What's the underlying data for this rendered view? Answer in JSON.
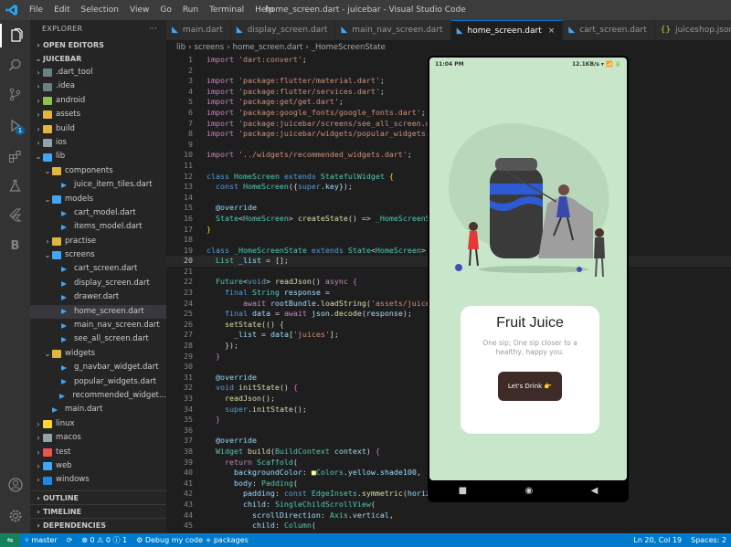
{
  "titlebar": {
    "menu": [
      "File",
      "Edit",
      "Selection",
      "View",
      "Go",
      "Run",
      "Terminal",
      "Help"
    ],
    "title": "home_screen.dart - juicebar - Visual Studio Code"
  },
  "activity_bar": {
    "icons": [
      "files-icon",
      "search-icon",
      "source-control-icon",
      "run-debug-icon",
      "extensions-icon",
      "testing-icon",
      "flutter-icon",
      "bloc-icon"
    ],
    "debug_badge": "1",
    "bottom_icons": [
      "account-icon",
      "settings-gear-icon"
    ]
  },
  "sidebar": {
    "title": "EXPLORER",
    "open_editors": "OPEN EDITORS",
    "project": "JUICEBAR",
    "tree": [
      {
        "label": ".dart_tool",
        "depth": 1,
        "type": "folder",
        "open": false
      },
      {
        "label": ".idea",
        "depth": 1,
        "type": "folder",
        "open": false
      },
      {
        "label": "android",
        "depth": 1,
        "type": "folder",
        "open": false
      },
      {
        "label": "assets",
        "depth": 1,
        "type": "folder",
        "open": false
      },
      {
        "label": "build",
        "depth": 1,
        "type": "folder",
        "open": false
      },
      {
        "label": "ios",
        "depth": 1,
        "type": "folder",
        "open": false
      },
      {
        "label": "lib",
        "depth": 1,
        "type": "folder",
        "open": true
      },
      {
        "label": "components",
        "depth": 2,
        "type": "folder",
        "open": true
      },
      {
        "label": "juice_item_tiles.dart",
        "depth": 3,
        "type": "dart"
      },
      {
        "label": "models",
        "depth": 2,
        "type": "folder",
        "open": true
      },
      {
        "label": "cart_model.dart",
        "depth": 3,
        "type": "dart"
      },
      {
        "label": "items_model.dart",
        "depth": 3,
        "type": "dart"
      },
      {
        "label": "practise",
        "depth": 2,
        "type": "folder",
        "open": false
      },
      {
        "label": "screens",
        "depth": 2,
        "type": "folder",
        "open": true
      },
      {
        "label": "cart_screen.dart",
        "depth": 3,
        "type": "dart"
      },
      {
        "label": "display_screen.dart",
        "depth": 3,
        "type": "dart"
      },
      {
        "label": "drawer.dart",
        "depth": 3,
        "type": "dart"
      },
      {
        "label": "home_screen.dart",
        "depth": 3,
        "type": "dart",
        "selected": true
      },
      {
        "label": "main_nav_screen.dart",
        "depth": 3,
        "type": "dart"
      },
      {
        "label": "see_all_screen.dart",
        "depth": 3,
        "type": "dart"
      },
      {
        "label": "widgets",
        "depth": 2,
        "type": "folder",
        "open": true
      },
      {
        "label": "g_navbar_widget.dart",
        "depth": 3,
        "type": "dart"
      },
      {
        "label": "popular_widgets.dart",
        "depth": 3,
        "type": "dart"
      },
      {
        "label": "recommended_widget...",
        "depth": 3,
        "type": "dart"
      },
      {
        "label": "main.dart",
        "depth": 2,
        "type": "dart"
      },
      {
        "label": "linux",
        "depth": 1,
        "type": "folder",
        "open": false
      },
      {
        "label": "macos",
        "depth": 1,
        "type": "folder",
        "open": false
      },
      {
        "label": "test",
        "depth": 1,
        "type": "folder",
        "open": false
      },
      {
        "label": "web",
        "depth": 1,
        "type": "folder",
        "open": false
      },
      {
        "label": "windows",
        "depth": 1,
        "type": "folder",
        "open": false
      }
    ],
    "outline": "OUTLINE",
    "timeline": "TIMELINE",
    "dependencies": "DEPENDENCIES"
  },
  "tabs": [
    {
      "label": "main.dart",
      "icon": "dart",
      "active": false
    },
    {
      "label": "display_screen.dart",
      "icon": "dart",
      "active": false
    },
    {
      "label": "main_nav_screen.dart",
      "icon": "dart",
      "active": false
    },
    {
      "label": "home_screen.dart",
      "icon": "dart",
      "active": true,
      "close": "×"
    },
    {
      "label": "cart_screen.dart",
      "icon": "dart",
      "active": false
    },
    {
      "label": "juiceshop.json",
      "icon": "json",
      "active": false
    }
  ],
  "breadcrumb": [
    "lib",
    "screens",
    "home_screen.dart",
    "_HomeScreenState"
  ],
  "editor": {
    "current_line": 20,
    "lines": [
      [
        [
          "import ",
          "#c586c0"
        ],
        [
          "'dart:convert'",
          "#ce9178"
        ],
        [
          ";",
          "#d4d4d4"
        ]
      ],
      [],
      [
        [
          "import ",
          "#c586c0"
        ],
        [
          "'package:flutter/material.dart'",
          "#ce9178"
        ],
        [
          ";",
          "#d4d4d4"
        ]
      ],
      [
        [
          "import ",
          "#c586c0"
        ],
        [
          "'package:flutter/services.dart'",
          "#ce9178"
        ],
        [
          ";",
          "#d4d4d4"
        ]
      ],
      [
        [
          "import ",
          "#c586c0"
        ],
        [
          "'package:get/get.dart'",
          "#ce9178"
        ],
        [
          ";",
          "#d4d4d4"
        ]
      ],
      [
        [
          "import ",
          "#c586c0"
        ],
        [
          "'package:google_fonts/google_fonts.dart'",
          "#ce9178"
        ],
        [
          ";",
          "#d4d4d4"
        ]
      ],
      [
        [
          "import ",
          "#c586c0"
        ],
        [
          "'package:juicebar/screens/see_all_screen.dart'",
          "#ce9178"
        ],
        [
          ";",
          "#d4d4d4"
        ]
      ],
      [
        [
          "import ",
          "#c586c0"
        ],
        [
          "'package:juicebar/widgets/popular_widgets.dart'",
          "#ce9178"
        ],
        [
          ";",
          "#d4d4d4"
        ]
      ],
      [],
      [
        [
          "import ",
          "#c586c0"
        ],
        [
          "'../widgets/recommended_widgets.dart'",
          "#ce9178"
        ],
        [
          ";",
          "#d4d4d4"
        ]
      ],
      [],
      [
        [
          "class ",
          "#569cd6"
        ],
        [
          "HomeScreen ",
          "#4ec9b0"
        ],
        [
          "extends ",
          "#569cd6"
        ],
        [
          "StatefulWidget ",
          "#4ec9b0"
        ],
        [
          "{",
          "#ffd700"
        ]
      ],
      [
        [
          "  const ",
          "#569cd6"
        ],
        [
          "HomeScreen",
          "#4ec9b0"
        ],
        [
          "({",
          "#d4d4d4"
        ],
        [
          "super",
          "#569cd6"
        ],
        [
          ".",
          "#d4d4d4"
        ],
        [
          "key",
          "#9cdcfe"
        ],
        [
          "});",
          "#d4d4d4"
        ]
      ],
      [],
      [
        [
          "  @override",
          "#9cdcfe"
        ]
      ],
      [
        [
          "  State",
          "#4ec9b0"
        ],
        [
          "<",
          "#d4d4d4"
        ],
        [
          "HomeScreen",
          "#4ec9b0"
        ],
        [
          "> ",
          "#d4d4d4"
        ],
        [
          "createState",
          "#dcdcaa"
        ],
        [
          "() => ",
          "#d4d4d4"
        ],
        [
          "_HomeScreenState",
          "#4ec9b0"
        ],
        [
          "();",
          "#d4d4d4"
        ]
      ],
      [
        [
          "}",
          "#ffd700"
        ]
      ],
      [],
      [
        [
          "class ",
          "#569cd6"
        ],
        [
          "_HomeScreenState ",
          "#4ec9b0"
        ],
        [
          "extends ",
          "#569cd6"
        ],
        [
          "State",
          "#4ec9b0"
        ],
        [
          "<",
          "#d4d4d4"
        ],
        [
          "HomeScreen",
          "#4ec9b0"
        ],
        [
          "> ",
          "#d4d4d4"
        ],
        [
          "{",
          "#ffd700"
        ]
      ],
      [
        [
          "  List ",
          "#4ec9b0"
        ],
        [
          "_list ",
          "#9cdcfe"
        ],
        [
          "= [];",
          "#d4d4d4"
        ]
      ],
      [],
      [
        [
          "  Future",
          "#4ec9b0"
        ],
        [
          "<",
          "#d4d4d4"
        ],
        [
          "void",
          "#569cd6"
        ],
        [
          "> ",
          "#d4d4d4"
        ],
        [
          "readJson",
          "#dcdcaa"
        ],
        [
          "() ",
          "#d4d4d4"
        ],
        [
          "async ",
          "#c586c0"
        ],
        [
          "{",
          "#da70d6"
        ]
      ],
      [
        [
          "    final ",
          "#569cd6"
        ],
        [
          "String ",
          "#4ec9b0"
        ],
        [
          "response ",
          "#9cdcfe"
        ],
        [
          "=",
          "#d4d4d4"
        ]
      ],
      [
        [
          "        await ",
          "#c586c0"
        ],
        [
          "rootBundle",
          "#9cdcfe"
        ],
        [
          ".",
          "#d4d4d4"
        ],
        [
          "loadString",
          "#dcdcaa"
        ],
        [
          "(",
          "#d4d4d4"
        ],
        [
          "'assets/juiceshop.json'",
          "#ce9178"
        ],
        [
          ");",
          "#d4d4d4"
        ]
      ],
      [
        [
          "    final ",
          "#569cd6"
        ],
        [
          "data ",
          "#9cdcfe"
        ],
        [
          "= ",
          "#d4d4d4"
        ],
        [
          "await ",
          "#c586c0"
        ],
        [
          "json",
          "#9cdcfe"
        ],
        [
          ".",
          "#d4d4d4"
        ],
        [
          "decode",
          "#dcdcaa"
        ],
        [
          "(",
          "#d4d4d4"
        ],
        [
          "response",
          "#9cdcfe"
        ],
        [
          ");",
          "#d4d4d4"
        ]
      ],
      [
        [
          "    setState",
          "#dcdcaa"
        ],
        [
          "(() {",
          "#d4d4d4"
        ]
      ],
      [
        [
          "      _list ",
          "#9cdcfe"
        ],
        [
          "= ",
          "#d4d4d4"
        ],
        [
          "data",
          "#9cdcfe"
        ],
        [
          "[",
          "#d4d4d4"
        ],
        [
          "'juices'",
          "#ce9178"
        ],
        [
          "];",
          "#d4d4d4"
        ]
      ],
      [
        [
          "    });",
          "#d4d4d4"
        ]
      ],
      [
        [
          "  }",
          "#da70d6"
        ]
      ],
      [],
      [
        [
          "  @override",
          "#9cdcfe"
        ]
      ],
      [
        [
          "  void ",
          "#569cd6"
        ],
        [
          "initState",
          "#dcdcaa"
        ],
        [
          "() ",
          "#d4d4d4"
        ],
        [
          "{",
          "#da70d6"
        ]
      ],
      [
        [
          "    readJson",
          "#dcdcaa"
        ],
        [
          "();",
          "#d4d4d4"
        ]
      ],
      [
        [
          "    super",
          "#569cd6"
        ],
        [
          ".",
          "#d4d4d4"
        ],
        [
          "initState",
          "#dcdcaa"
        ],
        [
          "();",
          "#d4d4d4"
        ]
      ],
      [
        [
          "  }",
          "#da70d6"
        ]
      ],
      [],
      [
        [
          "  @override",
          "#9cdcfe"
        ]
      ],
      [
        [
          "  Widget ",
          "#4ec9b0"
        ],
        [
          "build",
          "#dcdcaa"
        ],
        [
          "(",
          "#d4d4d4"
        ],
        [
          "BuildContext ",
          "#4ec9b0"
        ],
        [
          "context",
          "#9cdcfe"
        ],
        [
          ") ",
          "#d4d4d4"
        ],
        [
          "{",
          "#da70d6"
        ]
      ],
      [
        [
          "    return ",
          "#c586c0"
        ],
        [
          "Scaffold",
          "#4ec9b0"
        ],
        [
          "(",
          "#d4d4d4"
        ]
      ],
      [
        [
          "      backgroundColor",
          "#9cdcfe"
        ],
        [
          ": ",
          "#d4d4d4"
        ],
        [
          "■",
          "#fff59d"
        ],
        [
          "Colors",
          "#4ec9b0"
        ],
        [
          ".",
          "#d4d4d4"
        ],
        [
          "yellow",
          "#9cdcfe"
        ],
        [
          ".",
          "#d4d4d4"
        ],
        [
          "shade100",
          "#9cdcfe"
        ],
        [
          ",",
          "#d4d4d4"
        ]
      ],
      [
        [
          "      body",
          "#9cdcfe"
        ],
        [
          ": ",
          "#d4d4d4"
        ],
        [
          "Padding",
          "#4ec9b0"
        ],
        [
          "(",
          "#d4d4d4"
        ]
      ],
      [
        [
          "        padding",
          "#9cdcfe"
        ],
        [
          ": ",
          "#d4d4d4"
        ],
        [
          "const ",
          "#569cd6"
        ],
        [
          "EdgeInsets",
          "#4ec9b0"
        ],
        [
          ".",
          "#d4d4d4"
        ],
        [
          "symmetric",
          "#dcdcaa"
        ],
        [
          "(",
          "#d4d4d4"
        ],
        [
          "horizontal",
          "#9cdcfe"
        ],
        [
          ": ",
          "#d4d4d4"
        ],
        [
          "10",
          "#b5cea8"
        ],
        [
          "),",
          "#d4d4d4"
        ]
      ],
      [
        [
          "        child",
          "#9cdcfe"
        ],
        [
          ": ",
          "#d4d4d4"
        ],
        [
          "SingleChildScrollView",
          "#4ec9b0"
        ],
        [
          "(",
          "#d4d4d4"
        ]
      ],
      [
        [
          "          scrollDirection",
          "#9cdcfe"
        ],
        [
          ": ",
          "#d4d4d4"
        ],
        [
          "Axis",
          "#4ec9b0"
        ],
        [
          ".",
          "#d4d4d4"
        ],
        [
          "vertical",
          "#9cdcfe"
        ],
        [
          ",",
          "#d4d4d4"
        ]
      ],
      [
        [
          "          child",
          "#9cdcfe"
        ],
        [
          ": ",
          "#d4d4d4"
        ],
        [
          "Column",
          "#4ec9b0"
        ],
        [
          "(",
          "#d4d4d4"
        ]
      ]
    ]
  },
  "emulator": {
    "time": "11:04 PM",
    "status_right": "12.1KB/s ▾ 📶 🔋",
    "card_title": "Fruit Juice",
    "card_subtitle": "One sip; One sip closer to a healthy, happy you.",
    "button_label": "Let's Drink 👉",
    "nav": [
      "■",
      "◉",
      "◀"
    ]
  },
  "statusbar": {
    "remote": "⇋",
    "branch": "master",
    "sync": "⟳",
    "problems": "⊗ 0 ⚠ 0 ⓘ 1",
    "debug": "Debug my code + packages",
    "position": "Ln 20, Col 19",
    "spaces": "Spaces: 2"
  }
}
